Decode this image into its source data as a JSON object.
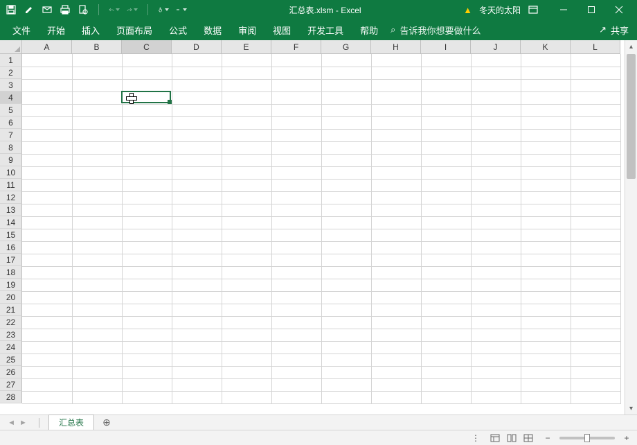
{
  "title": "汇总表.xlsm  -  Excel",
  "user": "冬天的太阳",
  "ribbon_tabs": [
    "文件",
    "开始",
    "插入",
    "页面布局",
    "公式",
    "数据",
    "审阅",
    "视图",
    "开发工具",
    "帮助"
  ],
  "tellme": "告诉我你想要做什么",
  "share": "共享",
  "columns": [
    "A",
    "B",
    "C",
    "D",
    "E",
    "F",
    "G",
    "H",
    "I",
    "J",
    "K",
    "L"
  ],
  "rows": [
    "1",
    "2",
    "3",
    "4",
    "5",
    "6",
    "7",
    "8",
    "9",
    "10",
    "11",
    "12",
    "13",
    "14",
    "15",
    "16",
    "17",
    "18",
    "19",
    "20",
    "21",
    "22",
    "23",
    "24",
    "25",
    "26",
    "27",
    "28"
  ],
  "active_cell": {
    "col": "C",
    "row": "4",
    "col_index": 2,
    "row_index": 3
  },
  "sheet_tab": "汇总表",
  "new_sheet_label": "+"
}
